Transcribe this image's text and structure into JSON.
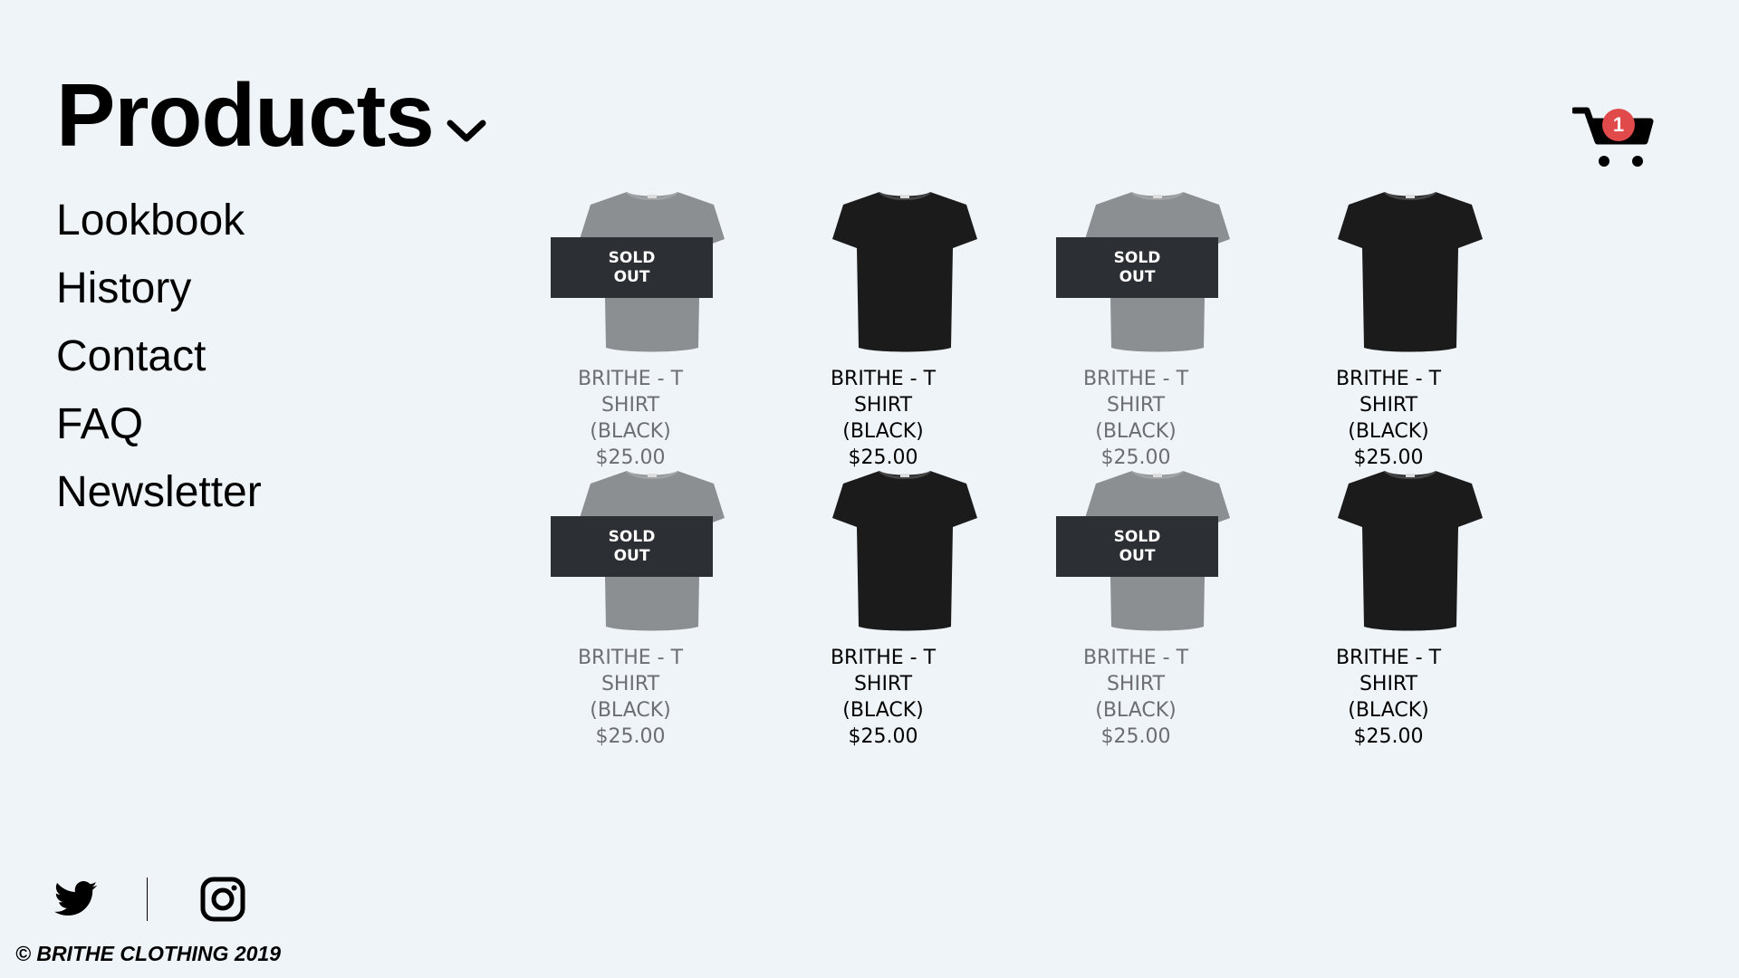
{
  "nav": {
    "title": "Products",
    "items": [
      {
        "label": "Lookbook"
      },
      {
        "label": "History"
      },
      {
        "label": "Contact"
      },
      {
        "label": "FAQ"
      },
      {
        "label": "Newsletter"
      }
    ]
  },
  "cart": {
    "count": "1",
    "icon": "cart-icon",
    "badge_color": "#e04a4a"
  },
  "products": [
    {
      "name_line1": "BRITHE - T",
      "name_line2": "SHIRT",
      "name_line3": "(BLACK)",
      "price": "$25.00",
      "sold_out": true,
      "sold_line1": "SOLD",
      "sold_line2": "OUT",
      "shirt_color": "#8c8f92"
    },
    {
      "name_line1": "BRITHE - T",
      "name_line2": "SHIRT",
      "name_line3": "(BLACK)",
      "price": "$25.00",
      "sold_out": false,
      "shirt_color": "#1b1b1b"
    },
    {
      "name_line1": "BRITHE - T",
      "name_line2": "SHIRT",
      "name_line3": "(BLACK)",
      "price": "$25.00",
      "sold_out": true,
      "sold_line1": "SOLD",
      "sold_line2": "OUT",
      "shirt_color": "#8c8f92"
    },
    {
      "name_line1": "BRITHE - T",
      "name_line2": "SHIRT",
      "name_line3": "(BLACK)",
      "price": "$25.00",
      "sold_out": false,
      "shirt_color": "#1b1b1b"
    },
    {
      "name_line1": "BRITHE - T",
      "name_line2": "SHIRT",
      "name_line3": "(BLACK)",
      "price": "$25.00",
      "sold_out": true,
      "sold_line1": "SOLD",
      "sold_line2": "OUT",
      "shirt_color": "#8c8f92"
    },
    {
      "name_line1": "BRITHE - T",
      "name_line2": "SHIRT",
      "name_line3": "(BLACK)",
      "price": "$25.00",
      "sold_out": false,
      "shirt_color": "#1b1b1b"
    },
    {
      "name_line1": "BRITHE - T",
      "name_line2": "SHIRT",
      "name_line3": "(BLACK)",
      "price": "$25.00",
      "sold_out": true,
      "sold_line1": "SOLD",
      "sold_line2": "OUT",
      "shirt_color": "#8c8f92"
    },
    {
      "name_line1": "BRITHE - T",
      "name_line2": "SHIRT",
      "name_line3": "(BLACK)",
      "price": "$25.00",
      "sold_out": false,
      "shirt_color": "#1b1b1b"
    }
  ],
  "footer": {
    "social": [
      {
        "icon": "twitter-icon"
      },
      {
        "icon": "instagram-icon"
      }
    ],
    "copyright": "© BRITHE CLOTHING 2019"
  },
  "colors": {
    "background": "#eff4f8",
    "sold_overlay": "#2c2f33",
    "muted_text": "#6b6e72"
  }
}
